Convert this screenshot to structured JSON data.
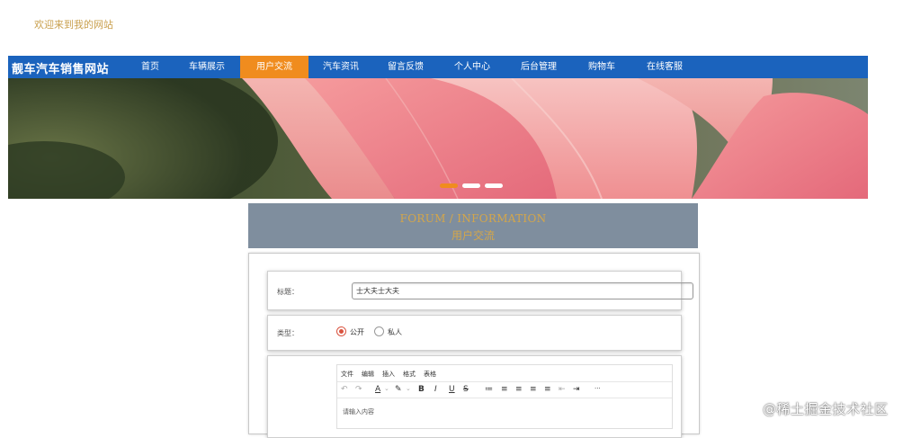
{
  "welcome_text": "欢迎来到我的网站",
  "brand": "靓车汽车销售网站",
  "nav": [
    {
      "label": "首页"
    },
    {
      "label": "车辆展示"
    },
    {
      "label": "用户交流",
      "active": true
    },
    {
      "label": "汽车资讯"
    },
    {
      "label": "留言反馈"
    },
    {
      "label": "个人中心"
    },
    {
      "label": "后台管理"
    },
    {
      "label": "购物车"
    },
    {
      "label": "在线客服"
    }
  ],
  "carousel": {
    "slides": 3,
    "active_index": 0
  },
  "forum": {
    "title_en": "FORUM / INFORMATION",
    "title_cn": "用户交流"
  },
  "form": {
    "title_label": "标题：",
    "title_value": "士大夫士大夫",
    "type_label": "类型：",
    "type_options": [
      {
        "label": "公开",
        "checked": true
      },
      {
        "label": "私人",
        "checked": false
      }
    ],
    "editor": {
      "menus": [
        "文件",
        "编辑",
        "插入",
        "格式",
        "表格"
      ],
      "toolbar": [
        "↶",
        "↷",
        "A",
        "⌄",
        "✎",
        "⌄",
        "B",
        "I",
        "U",
        "S",
        "≔",
        "≡",
        "≡",
        "≡",
        "≡",
        "⇤",
        "⇥",
        "···"
      ],
      "placeholder": "请输入内容"
    }
  },
  "watermark": "@稀土掘金技术社区",
  "colors": {
    "nav_bg": "#1b63bd",
    "nav_active": "#f08c1e",
    "forum_header_bg": "#7f8e9e",
    "accent_gold": "#d4a64a",
    "radio_checked": "#d9533f"
  }
}
